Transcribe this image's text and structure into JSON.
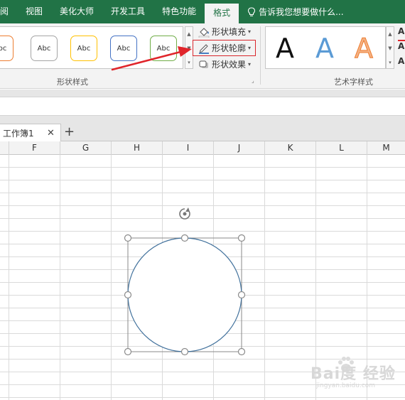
{
  "ribbon_tabs": [
    {
      "label": "阅",
      "active": false
    },
    {
      "label": "视图",
      "active": false
    },
    {
      "label": "美化大师",
      "active": false
    },
    {
      "label": "开发工具",
      "active": false
    },
    {
      "label": "特色功能",
      "active": false
    },
    {
      "label": "格式",
      "active": true
    }
  ],
  "tell_me": {
    "icon": "lightbulb-icon",
    "placeholder": "告诉我您想要做什么..."
  },
  "shape_styles": {
    "group_label": "形状样式",
    "gallery": [
      {
        "label": "Abc",
        "border_color": "#ed7d31"
      },
      {
        "label": "Abc",
        "border_color": "#a5a5a5"
      },
      {
        "label": "Abc",
        "border_color": "#ffc000"
      },
      {
        "label": "Abc",
        "border_color": "#4472c4"
      },
      {
        "label": "Abc",
        "border_color": "#70ad47"
      }
    ],
    "commands": {
      "fill": {
        "label": "形状填充",
        "icon": "paint-bucket-icon"
      },
      "outline": {
        "label": "形状轮廓",
        "icon": "pencil-outline-icon"
      },
      "effects": {
        "label": "形状效果",
        "icon": "shape-effects-icon"
      }
    }
  },
  "wordart_styles": {
    "group_label": "艺术字样式",
    "gallery": [
      {
        "label": "A",
        "style": "black"
      },
      {
        "label": "A",
        "style": "blue-gradient"
      },
      {
        "label": "A",
        "style": "orange-outline"
      }
    ],
    "side_commands": [
      "A",
      "A",
      "A"
    ]
  },
  "workbook": {
    "tab_label": "工作簿1",
    "close_label": "✕",
    "new_label": "+"
  },
  "columns": [
    "F",
    "G",
    "H",
    "I",
    "J",
    "K",
    "L",
    "M"
  ],
  "watermark": {
    "text": "Bai度 经验",
    "subtext": "jingyan.baidu.com"
  },
  "colors": {
    "ribbon_green": "#217346",
    "highlight_red": "#d9262c",
    "arrow_red": "#e0252b",
    "shape_outline": "#41719c",
    "handle_gray": "#8a8a8a"
  }
}
